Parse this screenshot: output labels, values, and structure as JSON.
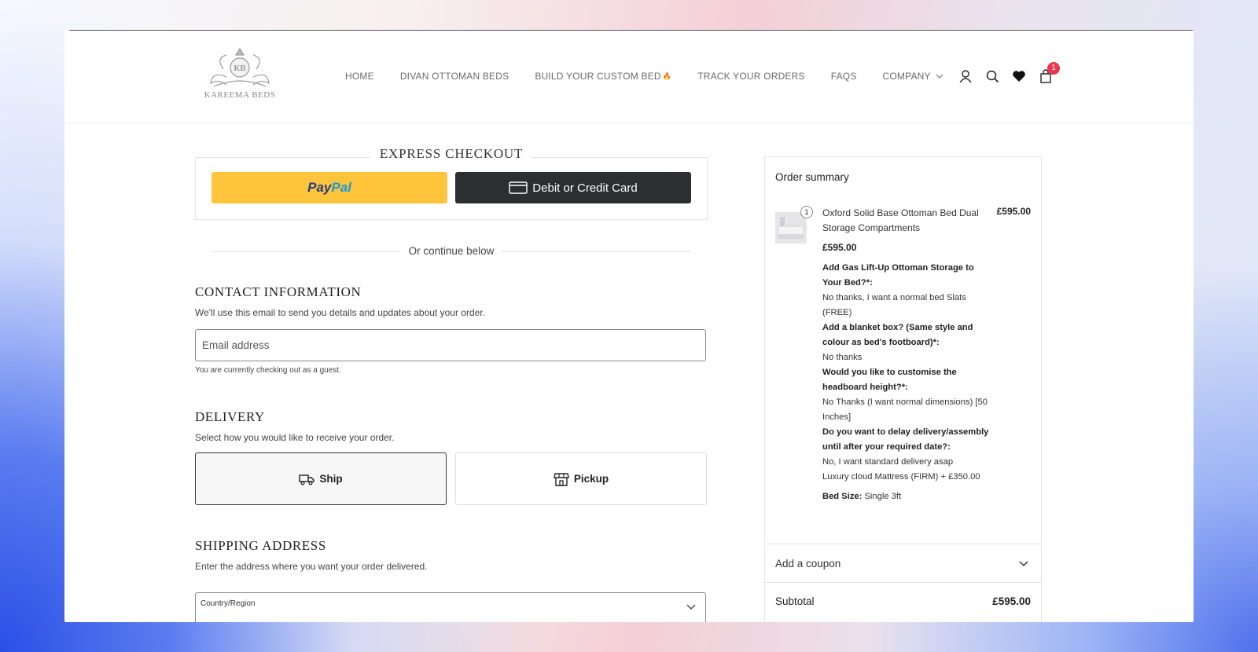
{
  "brand": {
    "logo_monogram": "KB",
    "logo_text": "KAREEMA BEDS"
  },
  "nav": {
    "items": [
      "HOME",
      "DIVAN OTTOMAN BEDS",
      "BUILD YOUR CUSTOM BED",
      "TRACK YOUR ORDERS",
      "FAQS",
      "COMPANY"
    ],
    "fire_glyph": "🔥"
  },
  "header_icons": {
    "cart_count": "1"
  },
  "express": {
    "title": "EXPRESS CHECKOUT",
    "paypal_a": "Pay",
    "paypal_b": "Pal",
    "card_label": "Debit or Credit Card"
  },
  "divider": "Or continue below",
  "contact": {
    "title": "CONTACT INFORMATION",
    "desc": "We'll use this email to send you details and updates about your order.",
    "email_placeholder": "Email address",
    "guest_note": "You are currently checking out as a guest."
  },
  "delivery": {
    "title": "DELIVERY",
    "desc": "Select how you would like to receive your order.",
    "ship_label": "Ship",
    "pickup_label": "Pickup"
  },
  "shipping": {
    "title": "SHIPPING ADDRESS",
    "desc": "Enter the address where you want your order delivered.",
    "country_label": "Country/Region"
  },
  "summary": {
    "title": "Order summary",
    "product": {
      "qty": "1",
      "name": "Oxford Solid Base Ottoman Bed Dual Storage Compartments",
      "price": "£595.00",
      "unit_price": "£595.00",
      "options": [
        {
          "q": "Add Gas Lift-Up Ottoman Storage to Your Bed?*:",
          "a": "No thanks, I want a normal bed Slats (FREE)"
        },
        {
          "q": "Add a blanket box? (Same style and colour as bed's footboard)*:",
          "a": "No thanks"
        },
        {
          "q": "Would you like to customise the headboard height?*:",
          "a": "No Thanks (I want normal dimensions) [50 Inches]"
        },
        {
          "q": "Do you want to delay delivery/assembly until after your required date?:",
          "a": "No, I want standard delivery asap"
        }
      ],
      "extra": "Luxury cloud Mattress (FIRM) + £350.00",
      "bed_size_label": "Bed Size:",
      "bed_size_value": "Single 3ft"
    },
    "coupon_label": "Add a coupon",
    "subtotal_label": "Subtotal",
    "subtotal_value": "£595.00"
  },
  "colors": {
    "paypal_yellow": "#fec43b",
    "card_dark": "#2c2e2f",
    "badge_red": "#e8374e"
  }
}
